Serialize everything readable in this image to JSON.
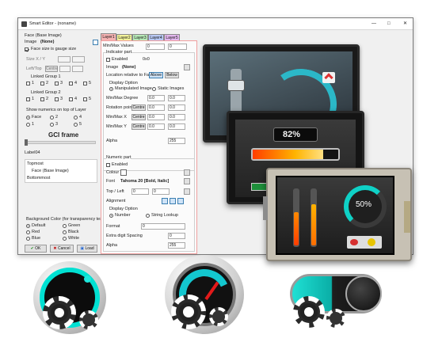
{
  "window": {
    "title": "Smart Editor - (noname)",
    "controls": [
      "—",
      "□",
      "✕"
    ]
  },
  "left_panel": {
    "face_label": "Face (Base Image)",
    "image_label": "Image",
    "image_value": "(None)",
    "face_is_gauge": "Face size is gauge size",
    "size_label": "Size X / Y",
    "lefttop_label": "Left/Top",
    "centre_label": "Centre",
    "linked_group_1": "Linked Group 1",
    "linked_group_2": "Linked Group 2",
    "group_nums": [
      "1",
      "2",
      "3",
      "4",
      "5"
    ],
    "show_numerics": "Show numerics on top of Layer",
    "layer_options": [
      "Face",
      "2",
      "4",
      "1",
      "3",
      "5"
    ],
    "gci_frame": "GCI frame",
    "label_id": "Label04",
    "tree": [
      "Topmost",
      "Face (Base Image)",
      "Bottommost"
    ],
    "bg_label": "Background Color (for transparency tests)",
    "bg_options": [
      "Default",
      "Green",
      "Red",
      "Black",
      "Blue",
      "White"
    ],
    "ok": "OK",
    "cancel": "Cancel",
    "load": "Load"
  },
  "tabs": [
    "Layer1",
    "Layer2",
    "Layer3",
    "Layer4",
    "Layer5"
  ],
  "tab_colors": [
    "#f6b3b3",
    "#f3f39a",
    "#b8eab8",
    "#b9c9f5",
    "#e3b7ee"
  ],
  "layer_panel": {
    "minmax_values": "Min/Max Values",
    "min_value": "0",
    "max_value": "0",
    "indicator_part": "Indicator part",
    "enabled": "Enabled",
    "count_value": "0x0",
    "image_label": "Image",
    "image_value": "(None)",
    "location_label": "Location relative to Face",
    "above": "Above",
    "below": "Below",
    "display_option": "Display Option",
    "manipulated_image": "Manipulated Image",
    "static_images": "Static Images",
    "minmax_degree": "Min/Max Degree",
    "degree_min": "0.0",
    "degree_max": "0.0",
    "rotation_point": "Rotation point",
    "rot_x": "0.0",
    "rot_y": "0.0",
    "minmax_x": "Min/Max X",
    "x_min": "0.0",
    "x_max": "0.0",
    "minmax_y": "Min/Max Y",
    "y_min": "0.0",
    "y_max": "0.0",
    "alpha": "Alpha",
    "alpha_value": "255",
    "numeric_part": "Numeric part",
    "colour": "Colour",
    "font": "Font",
    "font_value": "Tahoma 20 [Bold, Italic]",
    "top_left": "Top / Left",
    "top_value": "0",
    "left_value": "0",
    "alignment": "Alignment",
    "display_option2": "Display Option",
    "number": "Number",
    "string_lookup": "String Lookup",
    "format": "Format",
    "format_value": "0",
    "extra_digit_spacing": "Extra digit Spacing",
    "spacing_value": "0",
    "alpha2": "Alpha",
    "alpha2_value": "255"
  },
  "display": {
    "percent_main": "82%",
    "percent_round": "50%"
  },
  "icon_names": [
    "knob-gear-icon",
    "gauge-gear-icon",
    "toggle-gear-icon"
  ]
}
